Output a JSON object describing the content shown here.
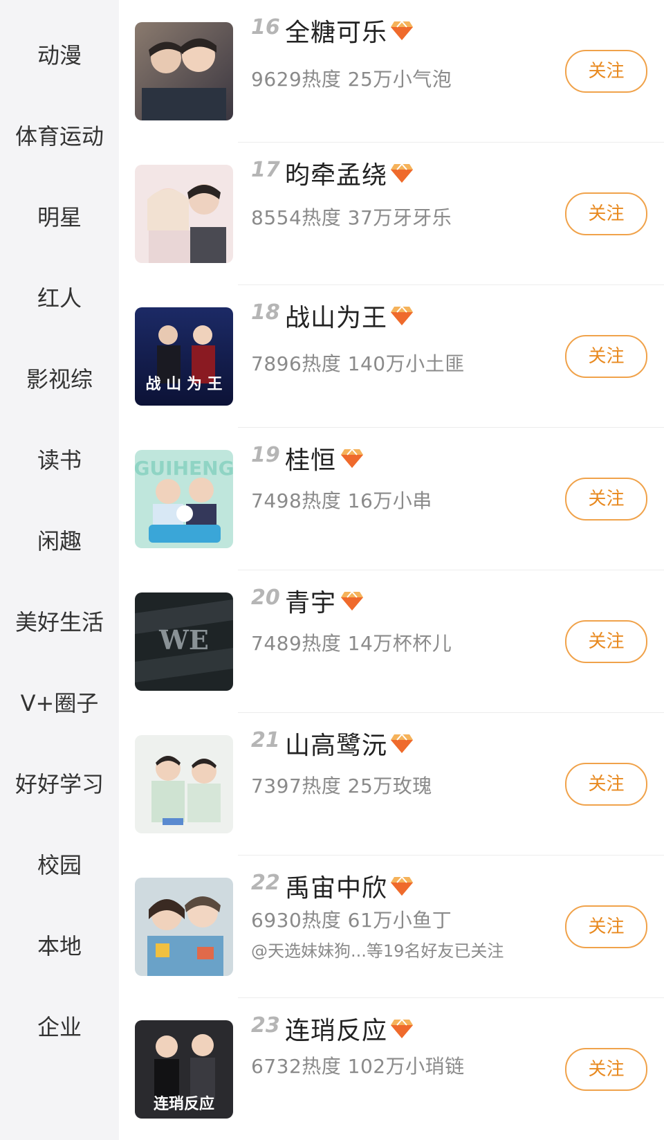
{
  "sidebar": {
    "items": [
      {
        "label": "动漫"
      },
      {
        "label": "体育运动"
      },
      {
        "label": "明星"
      },
      {
        "label": "红人"
      },
      {
        "label": "影视综"
      },
      {
        "label": "读书"
      },
      {
        "label": "闲趣"
      },
      {
        "label": "美好生活"
      },
      {
        "label": "V+圈子"
      },
      {
        "label": "好好学习"
      },
      {
        "label": "校园"
      },
      {
        "label": "本地"
      },
      {
        "label": "企业"
      }
    ]
  },
  "list": {
    "follow_label": "关注",
    "badge_icon": "diamond-badge-icon",
    "accent_color": "#e8891f",
    "items": [
      {
        "rank": "16",
        "name": "全糖可乐",
        "stats": "9629热度 25万小气泡",
        "friends": ""
      },
      {
        "rank": "17",
        "name": "昀牵孟绕",
        "stats": "8554热度 37万牙牙乐",
        "friends": ""
      },
      {
        "rank": "18",
        "name": "战山为王",
        "stats": "7896热度 140万小土匪",
        "friends": ""
      },
      {
        "rank": "19",
        "name": "桂恒",
        "stats": "7498热度 16万小串",
        "friends": ""
      },
      {
        "rank": "20",
        "name": "青宇",
        "stats": "7489热度 14万杯杯儿",
        "friends": ""
      },
      {
        "rank": "21",
        "name": "山高鹭沅",
        "stats": "7397热度 25万玫瑰",
        "friends": ""
      },
      {
        "rank": "22",
        "name": "禹宙中欣",
        "stats": "6930热度 61万小鱼丁",
        "friends": "@天选妹妹狗...等19名好友已关注"
      },
      {
        "rank": "23",
        "name": "连琑反应",
        "stats": "6732热度 102万小琑链",
        "friends": ""
      }
    ]
  }
}
